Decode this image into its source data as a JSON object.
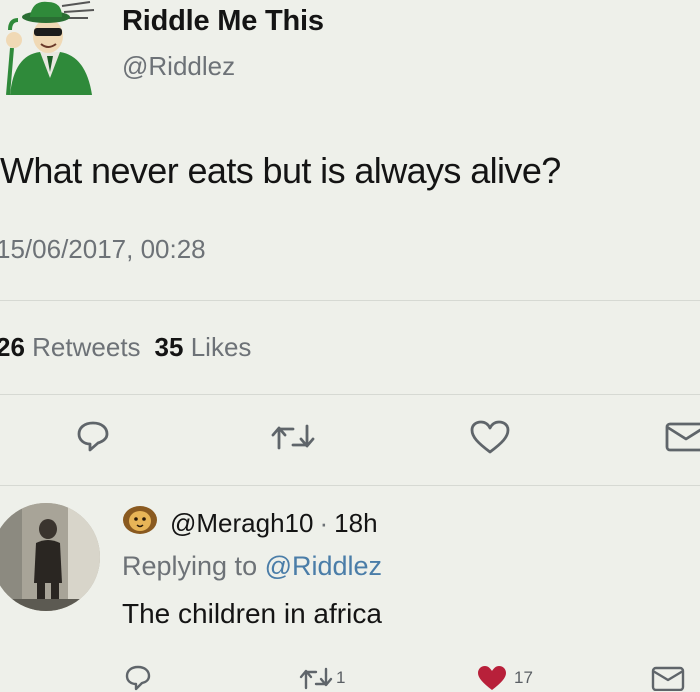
{
  "tweet": {
    "display_name": "Riddle Me This",
    "handle": "@Riddlez",
    "text": "What never eats but is always alive?",
    "timestamp": "15/06/2017, 00:28",
    "retweets_count": "26",
    "retweets_label": "Retweets",
    "likes_count": "35",
    "likes_label": "Likes"
  },
  "reply": {
    "handle": "@Meragh10",
    "separator": "·",
    "time": "18h",
    "replying_prefix": "Replying to",
    "replying_to": "@Riddlez",
    "text": "The children in africa",
    "retweet_count": "1",
    "like_count": "17"
  },
  "colors": {
    "background": "#eef0ea",
    "muted_text": "#6d7277",
    "mention": "#4a7da8",
    "like_red": "#b8203a"
  },
  "icons": {
    "actions": [
      "reply-icon",
      "retweet-icon",
      "like-icon",
      "dm-icon"
    ]
  }
}
